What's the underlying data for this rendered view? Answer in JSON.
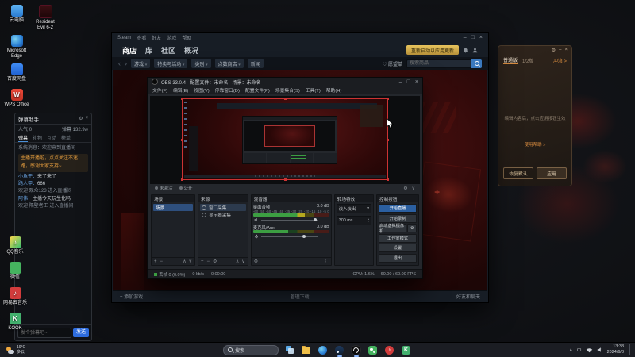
{
  "desktop": {
    "icons": [
      {
        "label": "云电脑"
      },
      {
        "label": "Resident Evil 6-2"
      },
      {
        "label": "Microsoft Edge"
      },
      {
        "label": "百度网盘"
      },
      {
        "label": "WPS Office"
      }
    ],
    "dock": [
      {
        "label": "QQ音乐"
      },
      {
        "label": "微信"
      },
      {
        "label": "网易云音乐"
      },
      {
        "label": "KOOK"
      }
    ]
  },
  "chat": {
    "title": "弹幕助手",
    "popularity_label": "人气",
    "popularity_value": "0",
    "danmu_label": "弹幕",
    "danmu_value": "132.9w",
    "tabs": [
      "弹幕",
      "礼物",
      "互动",
      "榜单"
    ],
    "messages": [
      {
        "text": "系统消息：欢迎来到直播间"
      },
      {
        "text": "主播开播啦，点点关注不迷路，感谢大家支持~"
      },
      {
        "name": "小鱼干：",
        "text": "来了来了"
      },
      {
        "name": "路人甲：",
        "text": "666"
      },
      {
        "text": "欢迎 观众123 进入直播间"
      },
      {
        "name": "阿伟：",
        "text": "主播今天玩生化吗"
      },
      {
        "text": "欢迎 隔壁老王 进入直播间"
      }
    ],
    "input_placeholder": "发个弹幕吧~",
    "send_label": "发送"
  },
  "steam": {
    "menu": [
      "Steam",
      "查看",
      "好友",
      "游戏",
      "帮助"
    ],
    "nav": [
      "商店",
      "库",
      "社区",
      "概况"
    ],
    "update_button": "重新启动以应用更新",
    "filters": [
      "游戏",
      "特卖与活动",
      "类别",
      "点数商店",
      "新闻"
    ],
    "search_placeholder": "搜索商品",
    "wishlist": "♡ 愿望单",
    "bottom": {
      "add_game": "+ 添加游戏",
      "downloads": "管理下载",
      "friends": "好友和聊天"
    }
  },
  "obs": {
    "title": "OBS 33.0.4 - 配置文件：未命名 - 场景：未命名",
    "menus": [
      "文件(F)",
      "编辑(E)",
      "视图(V)",
      "停靠窗口(D)",
      "配置文件(P)",
      "场景集合(S)",
      "工具(T)",
      "帮助(H)"
    ],
    "status_row": {
      "inactive": "未激活",
      "visibility": "公开"
    },
    "scenes": {
      "header": "场景",
      "items": [
        "场景"
      ]
    },
    "sources": {
      "header": "来源",
      "items": [
        "窗口采集",
        "显示器采集"
      ]
    },
    "mixer": {
      "header": "混音器",
      "ticks": "-60 -55 -50 -45 -40 -35 -30 -25 -20 -15 -10 -5 0",
      "channels": [
        {
          "name": "桌面音频",
          "db": "0.0 dB"
        },
        {
          "name": "麦克风/Aux",
          "db": "0.0 dB"
        }
      ]
    },
    "transitions": {
      "header": "转场特效",
      "selected": "淡入淡出",
      "duration": "300 ms"
    },
    "controls": {
      "header": "控制按钮",
      "buttons": [
        "开始直播",
        "开始录制",
        "启动虚拟摄像机",
        "工作室模式",
        "设置",
        "退出"
      ]
    },
    "statusbar": {
      "dropped": "丢帧 0 (0.0%)",
      "bitrate": "0 kb/s",
      "timer": "0:00:00",
      "cpu": "CPU: 1.6%",
      "fps": "60.00 / 60.00 FPS"
    }
  },
  "companion": {
    "tabs": [
      "普通版",
      "1/2版"
    ],
    "corner_link": "冲浪 >",
    "hint": "编辑内容后，点击应用按钮生效",
    "help_link": "使用帮助 >",
    "buttons": {
      "reset": "恢复默认",
      "apply": "应用"
    }
  },
  "taskbar": {
    "search": "搜索",
    "weather": {
      "temp": "19°C",
      "cond": "多云"
    },
    "tray": {
      "ime": "中",
      "time": "13:33",
      "date": "2024/6/8"
    }
  }
}
